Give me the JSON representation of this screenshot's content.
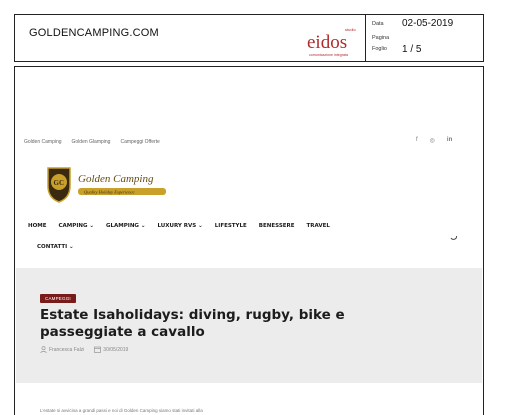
{
  "clipping": {
    "site": "GOLDENCAMPING.COM",
    "logo_text": "eidos",
    "logo_small": "studio",
    "logo_tagline": "comunicazione integrata",
    "data_label": "Data",
    "data_value": "02-05-2019",
    "pagina_label": "Pagina",
    "pagina_value": "",
    "foglio_label": "Foglio",
    "foglio_value": "1 / 5"
  },
  "topmenu": [
    "Golden Camping",
    "Golden Glamping",
    "Campeggi Offerte"
  ],
  "social": {
    "facebook": "f",
    "instagram": "◎",
    "linkedin": "in"
  },
  "brand": {
    "name": "Golden Camping",
    "tagline": "Quality Holiday Experience",
    "emblem": "GC"
  },
  "nav": {
    "row1": [
      "HOME",
      "CAMPING ⌄",
      "GLAMPING ⌄",
      "LUXURY RVS ⌄",
      "LIFESTYLE",
      "BENESSERE",
      "TRAVEL"
    ],
    "row2": [
      "CONTATTI ⌄"
    ]
  },
  "article": {
    "category": "CAMPEGGI",
    "title": "Estate Isaholidays: diving, rugby, bike e passeggiate a cavallo",
    "author": "Francesca Falzi",
    "date": "30/05/2019",
    "excerpt": "L'estate si avvicina a grandi passi e noi di Golden Camping siamo stati invitati alla"
  },
  "colors": {
    "category_bg": "#7a1b1b",
    "hero_bg": "#ececec",
    "brand_gold": "#c9a02a",
    "logo_red": "#b22a2a"
  }
}
